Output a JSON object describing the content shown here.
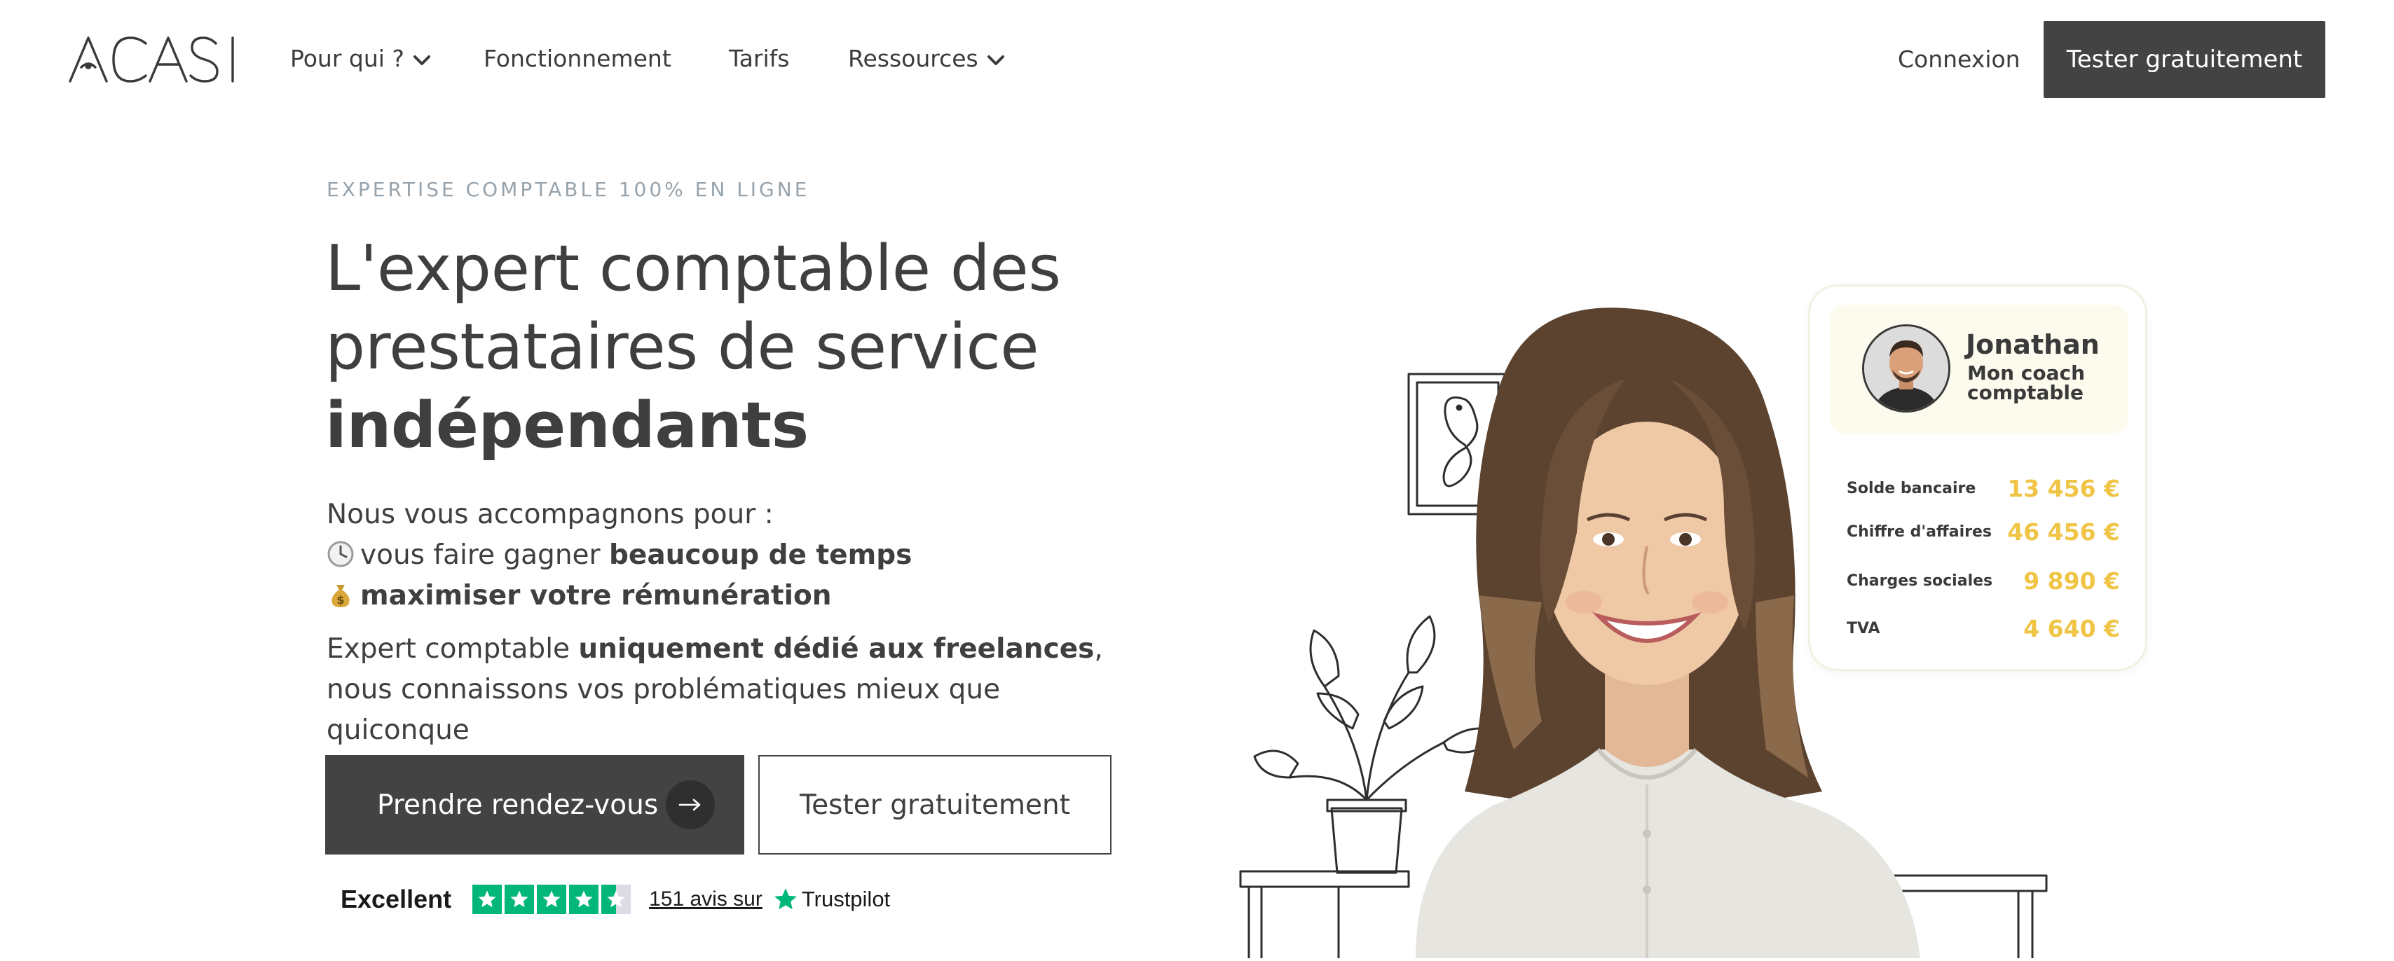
{
  "nav": {
    "logo_text": "ACASI",
    "items": [
      {
        "label": "Pour qui ?",
        "dropdown": true
      },
      {
        "label": "Fonctionnement",
        "dropdown": false
      },
      {
        "label": "Tarifs",
        "dropdown": false
      },
      {
        "label": "Ressources",
        "dropdown": true
      }
    ],
    "login_label": "Connexion",
    "cta_label": "Tester gratuitement"
  },
  "hero": {
    "eyebrow": "EXPERTISE COMPTABLE 100% EN LIGNE",
    "title_line1": "L'expert comptable des",
    "title_line2": "prestataires de service",
    "title_line3": "indépendants",
    "intro": "Nous vous accompagnons pour :",
    "bullet1_prefix": "vous faire gagner ",
    "bullet1_bold": "beaucoup de temps",
    "bullet1_icon": "clock-icon",
    "bullet2_bold": "maximiser votre rémunération",
    "bullet2_icon": "money-bag-icon",
    "para_prefix": "Expert comptable ",
    "para_bold": "uniquement dédié aux freelances",
    "para_suffix": ", nous connaissons vos problématiques mieux que quiconque",
    "primary_button": "Prendre rendez-vous",
    "secondary_button": "Tester gratuitement"
  },
  "trustpilot": {
    "rating_label": "Excellent",
    "stars": 4.5,
    "reviews_link": "151 avis sur",
    "brand": "Trustpilot",
    "brand_color": "#00b67a"
  },
  "coach_card": {
    "name": "Jonathan",
    "role": "Mon coach comptable",
    "rows": [
      {
        "label": "Solde bancaire",
        "value": "13 456 €"
      },
      {
        "label": "Chiffre d'affaires",
        "value": "46 456 €"
      },
      {
        "label": "Charges sociales",
        "value": "9 890 €"
      },
      {
        "label": "TVA",
        "value": "4 640 €"
      }
    ],
    "value_color": "#f0c445"
  },
  "colors": {
    "dark_button": "#434343",
    "text": "#3f3f3f",
    "eyebrow": "#97a3ac"
  }
}
